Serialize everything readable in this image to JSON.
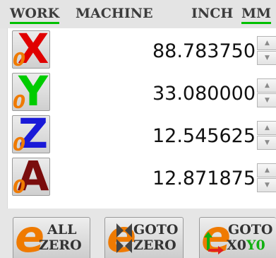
{
  "tabs": [
    {
      "label": "WORK",
      "active": true
    },
    {
      "label": "MACHINE",
      "active": false
    },
    {
      "label": "INCH",
      "active": false
    },
    {
      "label": "MM",
      "active": true
    }
  ],
  "axes": [
    {
      "name": "X",
      "value": "88.783750",
      "color": "#e00000"
    },
    {
      "name": "Y",
      "value": "33.080000",
      "color": "#00cc00"
    },
    {
      "name": "Z",
      "value": "12.545625",
      "color": "#1a1ad8"
    },
    {
      "name": "A",
      "value": "12.871875",
      "color": "#7a0d0d"
    }
  ],
  "zero_glyph": "0",
  "spinner": {
    "up": "▲",
    "down": "▼"
  },
  "buttons": {
    "all_zero": {
      "line1": "ALL",
      "line2": "ZERO"
    },
    "goto_zero": {
      "line1": "GOTO",
      "line2": "ZERO"
    },
    "goto_x0y0": {
      "line1": "GOTO",
      "x": "X0",
      "y": "Y0",
      "o": "0"
    }
  },
  "accent_color": "#ef7a00",
  "active_tab_color": "#00c000"
}
